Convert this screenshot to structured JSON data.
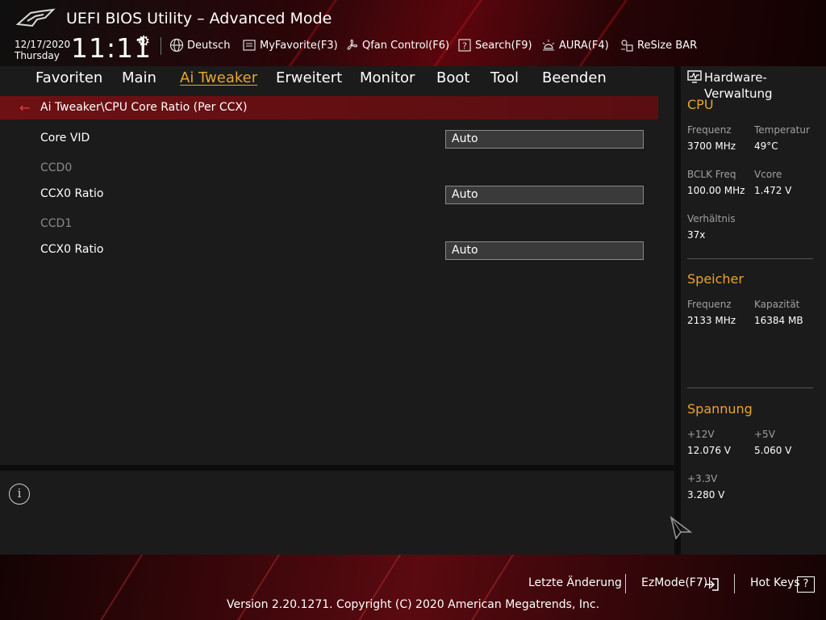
{
  "header": {
    "title": "UEFI BIOS Utility – Advanced Mode",
    "date": "12/17/2020",
    "weekday": "Thursday",
    "time": "11:11",
    "tools": [
      {
        "label": "Deutsch",
        "icon": "globe-icon"
      },
      {
        "label": "MyFavorite(F3)",
        "icon": "favorite-list-icon"
      },
      {
        "label": "Qfan Control(F6)",
        "icon": "fan-icon"
      },
      {
        "label": "Search(F9)",
        "icon": "search-help-icon"
      },
      {
        "label": "AURA(F4)",
        "icon": "aura-light-icon"
      },
      {
        "label": "ReSize BAR",
        "icon": "resize-bar-icon"
      }
    ]
  },
  "nav": {
    "tabs": [
      "Favoriten",
      "Main",
      "Ai Tweaker",
      "Erweitert",
      "Monitor",
      "Boot",
      "Tool",
      "Beenden"
    ],
    "active": "Ai Tweaker"
  },
  "breadcrumb": "Ai Tweaker\\CPU Core Ratio (Per CCX)",
  "settings": {
    "core_vid": {
      "label": "Core VID",
      "value": "Auto"
    },
    "ccd0": {
      "group": "CCD0",
      "label": "CCX0 Ratio",
      "value": "Auto"
    },
    "ccd1": {
      "group": "CCD1",
      "label": "CCX0 Ratio",
      "value": "Auto"
    }
  },
  "hardware": {
    "title": "Hardware-Verwaltung",
    "cpu": {
      "title": "CPU",
      "freq_label": "Frequenz",
      "freq_value": "3700 MHz",
      "temp_label": "Temperatur",
      "temp_value": "49°C",
      "bclk_label": "BCLK Freq",
      "bclk_value": "100.00 MHz",
      "vcore_label": "Vcore",
      "vcore_value": "1.472 V",
      "ratio_label": "Verhältnis",
      "ratio_value": "37x"
    },
    "memory": {
      "title": "Speicher",
      "freq_label": "Frequenz",
      "freq_value": "2133 MHz",
      "cap_label": "Kapazität",
      "cap_value": "16384 MB"
    },
    "voltage": {
      "title": "Spannung",
      "v12_label": "+12V",
      "v12_value": "12.076 V",
      "v5_label": "+5V",
      "v5_value": "5.060 V",
      "v33_label": "+3.3V",
      "v33_value": "3.280 V"
    }
  },
  "footer": {
    "last_change": "Letzte Änderung",
    "ezmode": "EzMode(F7)|",
    "hotkeys": "Hot Keys",
    "hotkeys_key": "?",
    "copyright": "Version 2.20.1271. Copyright (C) 2020 American Megatrends, Inc."
  },
  "colors": {
    "accent": "#e8a434",
    "breadcrumb_bg": "#6e1014",
    "background": "#1b1b1b"
  }
}
